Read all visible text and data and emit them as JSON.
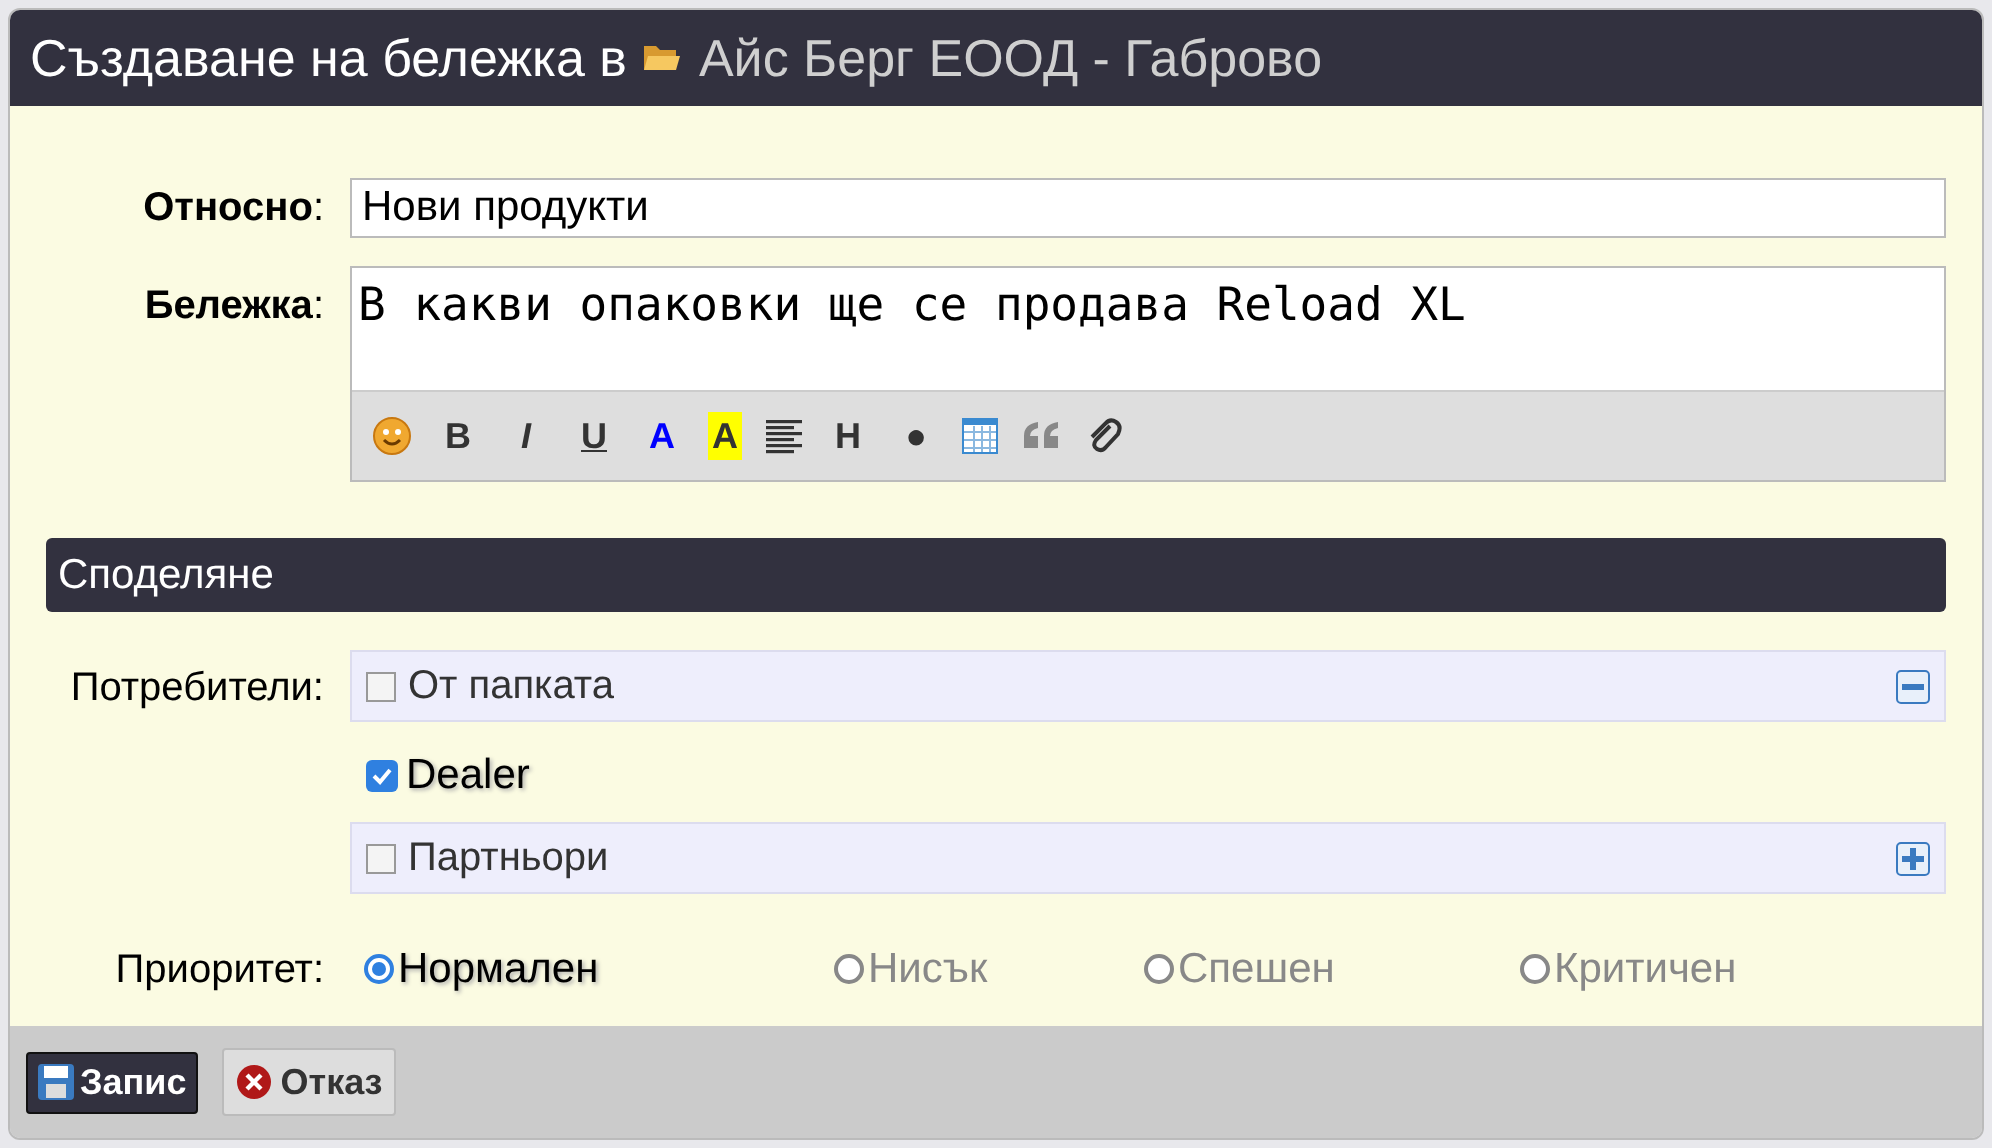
{
  "window": {
    "title": "Създаване на бележка в",
    "folder": "Айс Берг ЕООД - Габрово"
  },
  "subject": {
    "label": "**Относно**:",
    "value": "Нови продукти"
  },
  "note": {
    "label": "**Бележка**:",
    "value": "В какви опаковки ще се продава Reload XL"
  },
  "toolbar": [
    {
      "kind": "emoji"
    },
    {
      "kind": "bold",
      "label": "B"
    },
    {
      "kind": "italic",
      "label": "I"
    },
    {
      "kind": "underline",
      "label": "U"
    },
    {
      "kind": "color",
      "label": "A"
    },
    {
      "kind": "highlight",
      "label": "A"
    },
    {
      "kind": "align"
    },
    {
      "kind": "heading",
      "label": "H"
    },
    {
      "kind": "bullet",
      "label": "●"
    },
    {
      "kind": "table"
    },
    {
      "kind": "quote"
    },
    {
      "kind": "attach"
    }
  ],
  "sharing": {
    "title": "Споделяне",
    "users_label": "Потребители:",
    "users": [
      {
        "kind": "group",
        "label": "От папката",
        "checked": false,
        "expanded": true
      },
      {
        "kind": "user",
        "label": "Dealer",
        "checked": true
      },
      {
        "kind": "group",
        "label": "Партньори",
        "checked": false,
        "expanded": false
      }
    ],
    "priority_label": "Приоритет:",
    "priorities": [
      {
        "label": "Нормален",
        "selected": true
      },
      {
        "label": "Нисък",
        "selected": false
      },
      {
        "label": "Спешен",
        "selected": false
      },
      {
        "label": "Критичен",
        "selected": false
      }
    ]
  },
  "buttons": [
    {
      "kind": "save",
      "label": "Запис"
    },
    {
      "kind": "cancel",
      "label": "Отказ"
    }
  ]
}
